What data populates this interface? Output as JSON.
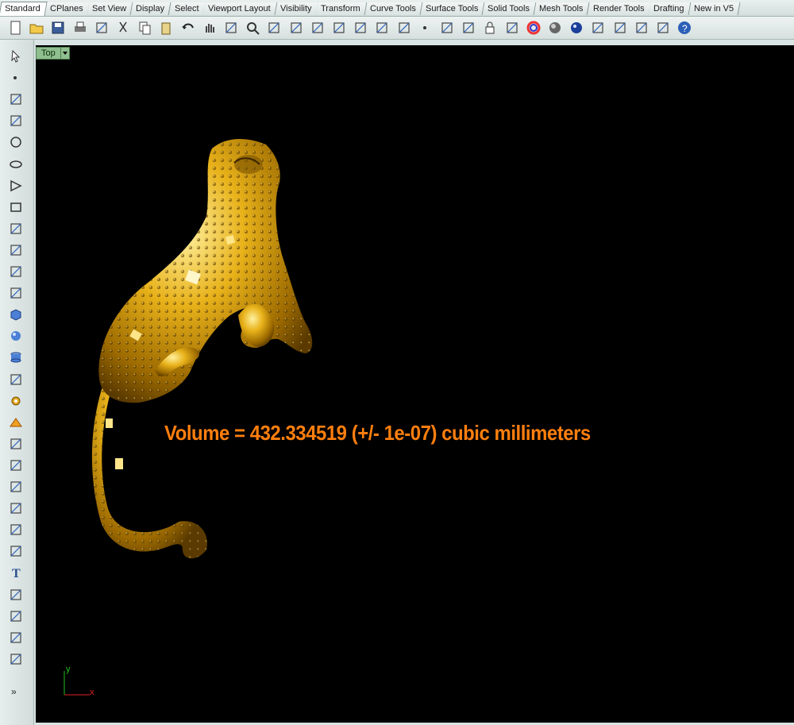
{
  "tabs": [
    "Standard",
    "CPlanes",
    "Set View",
    "Display",
    "Select",
    "Viewport Layout",
    "Visibility",
    "Transform",
    "Curve Tools",
    "Surface Tools",
    "Solid Tools",
    "Mesh Tools",
    "Render Tools",
    "Drafting",
    "New in V5"
  ],
  "active_tab": "Standard",
  "viewport": {
    "name": "Top",
    "volume_text": "Volume = 432.334519 (+/- 1e-07) cubic millimeters",
    "axis_x": "x",
    "axis_y": "y"
  },
  "left_toolbar_more": "»",
  "colors": {
    "model": "#d9a514",
    "volume_text": "#ff7f0e",
    "viewport_bg": "#000000"
  },
  "toolbar_icons": [
    "new-icon",
    "open-icon",
    "save-icon",
    "print-icon",
    "import-icon",
    "cut-icon",
    "copy-icon",
    "paste-icon",
    "undo-icon",
    "pan-icon",
    "rotate-icon",
    "zoom-icon",
    "zoom-window-icon",
    "zoom-extents-icon",
    "zoom-selected-icon",
    "undo-view-icon",
    "viewport-grid-icon",
    "car-icon",
    "mesh-icon",
    "point-icon",
    "snapshot-icon",
    "light-icon",
    "lock-icon",
    "layer-icon",
    "color-wheel-icon",
    "shaded-icon",
    "render-icon",
    "ghost-icon",
    "options-icon",
    "plugin-icon",
    "grid-snap-icon",
    "help-icon"
  ],
  "left_icons": [
    "select-icon",
    "point-icon",
    "polyline-icon",
    "curve-icon",
    "circle-icon",
    "ellipse-icon",
    "polygon-icon",
    "rectangle-icon",
    "arc-icon",
    "fillet-icon",
    "surface-icon",
    "loft-icon",
    "box-icon",
    "sphere-icon",
    "cylinder-icon",
    "mesh-icon",
    "gear-icon",
    "explode-icon",
    "trim-icon",
    "dimension-icon",
    "boolean-icon",
    "points-icon",
    "rotate-icon",
    "sweep-icon",
    "text-icon",
    "group-icon",
    "array-icon",
    "properties-icon",
    "cube-view-icon"
  ]
}
